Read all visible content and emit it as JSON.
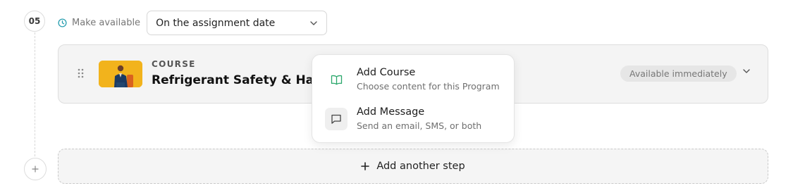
{
  "step": {
    "number": "05"
  },
  "availability": {
    "label": "Make available",
    "selected": "On the assignment date",
    "icon": "clock-icon",
    "icon_color": "#2a9fb0"
  },
  "course_card": {
    "kicker": "COURSE",
    "title": "Refrigerant Safety & Han",
    "status_badge": "Available immediately",
    "thumbnail_color": "#f2b31c"
  },
  "add_menu": {
    "items": [
      {
        "title": "Add Course",
        "subtitle": "Choose content for this Program",
        "icon": "book-open-icon",
        "icon_color": "#2aa76b"
      },
      {
        "title": "Add Message",
        "subtitle": "Send an email, SMS, or both",
        "icon": "message-square-icon",
        "icon_color": "#444444"
      }
    ]
  },
  "add_step": {
    "label": "Add another step"
  }
}
